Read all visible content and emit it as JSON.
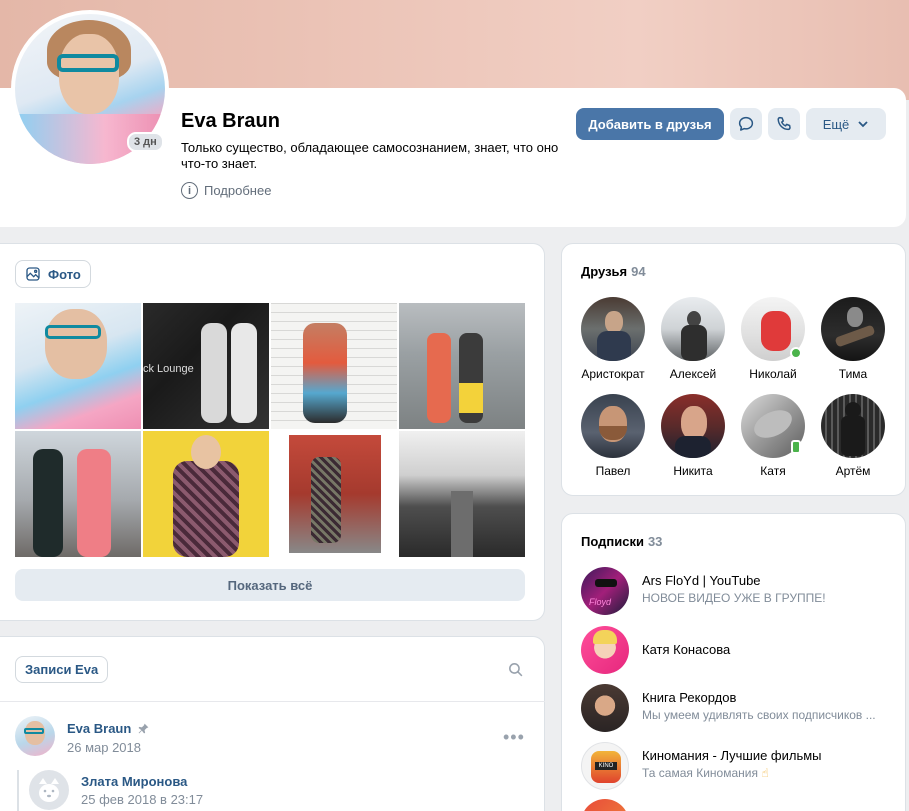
{
  "profile": {
    "name": "Eva Braun",
    "status": "Только существо, обладающее самосознанием, знает, что оно что-то знает.",
    "more_info": "Подробнее",
    "last_seen_badge": "3 дн"
  },
  "actions": {
    "add_friend": "Добавить в друзья",
    "more": "Ещё",
    "message_icon": "message-bubble-icon",
    "call_icon": "phone-icon"
  },
  "photos": {
    "tab_label": "Фото",
    "show_all": "Показать всё",
    "items": [
      {
        "alt": "photo-1"
      },
      {
        "alt": "photo-2"
      },
      {
        "alt": "photo-3"
      },
      {
        "alt": "photo-4"
      },
      {
        "alt": "photo-5"
      },
      {
        "alt": "photo-6"
      },
      {
        "alt": "photo-7"
      },
      {
        "alt": "photo-8"
      }
    ],
    "photo2_text": "ck Lounge"
  },
  "posts": {
    "tab_label": "Записи Eva",
    "post": {
      "author": "Eva Braun",
      "date": "26 мар 2018"
    },
    "repost": {
      "author": "Злата Миронова",
      "date": "25 фев 2018 в 23:17"
    }
  },
  "friends": {
    "title": "Друзья",
    "count": "94",
    "items": [
      {
        "name": "Аристократ"
      },
      {
        "name": "Алексей"
      },
      {
        "name": "Николай"
      },
      {
        "name": "Тима"
      },
      {
        "name": "Павел"
      },
      {
        "name": "Никита"
      },
      {
        "name": "Катя"
      },
      {
        "name": "Артём"
      }
    ]
  },
  "subscriptions": {
    "title": "Подписки",
    "count": "33",
    "items": [
      {
        "name": "Ars FloYd | YouTube",
        "subtitle": "НОВОЕ ВИДЕО УЖЕ В ГРУППЕ!"
      },
      {
        "name": "Катя Конасова",
        "subtitle": ""
      },
      {
        "name": "Книга Рекордов",
        "subtitle": "Мы умеем удивлять своих подписчиков ..."
      },
      {
        "name": "Киномания - Лучшие фильмы",
        "subtitle": "Та самая Киномания"
      }
    ]
  },
  "colors": {
    "accent": "#4a76a8",
    "link": "#2a5885",
    "online": "#4bb34b"
  }
}
